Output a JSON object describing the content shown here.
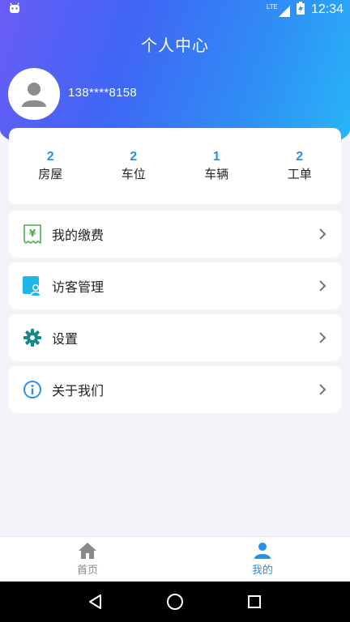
{
  "status_bar": {
    "network": "LTE",
    "time": "12:34"
  },
  "header": {
    "title": "个人中心",
    "phone": "138****8158"
  },
  "stats": [
    {
      "value": "2",
      "label": "房屋"
    },
    {
      "value": "2",
      "label": "车位"
    },
    {
      "value": "1",
      "label": "车辆"
    },
    {
      "value": "2",
      "label": "工单"
    }
  ],
  "menu": [
    {
      "label": "我的缴费",
      "icon": "payment-receipt-icon"
    },
    {
      "label": "访客管理",
      "icon": "visitor-icon"
    },
    {
      "label": "设置",
      "icon": "gear-icon"
    },
    {
      "label": "关于我们",
      "icon": "info-icon"
    }
  ],
  "tabs": [
    {
      "label": "首页",
      "icon": "home-icon",
      "active": false
    },
    {
      "label": "我的",
      "icon": "person-icon",
      "active": true
    }
  ],
  "colors": {
    "accent": "#2b8fe6",
    "payment_icon": "#4caf50",
    "visitor_icon": "#1fb6e8",
    "settings_icon": "#16888a",
    "info_icon": "#2b8fe6",
    "tab_inactive": "#8a8a8a"
  }
}
